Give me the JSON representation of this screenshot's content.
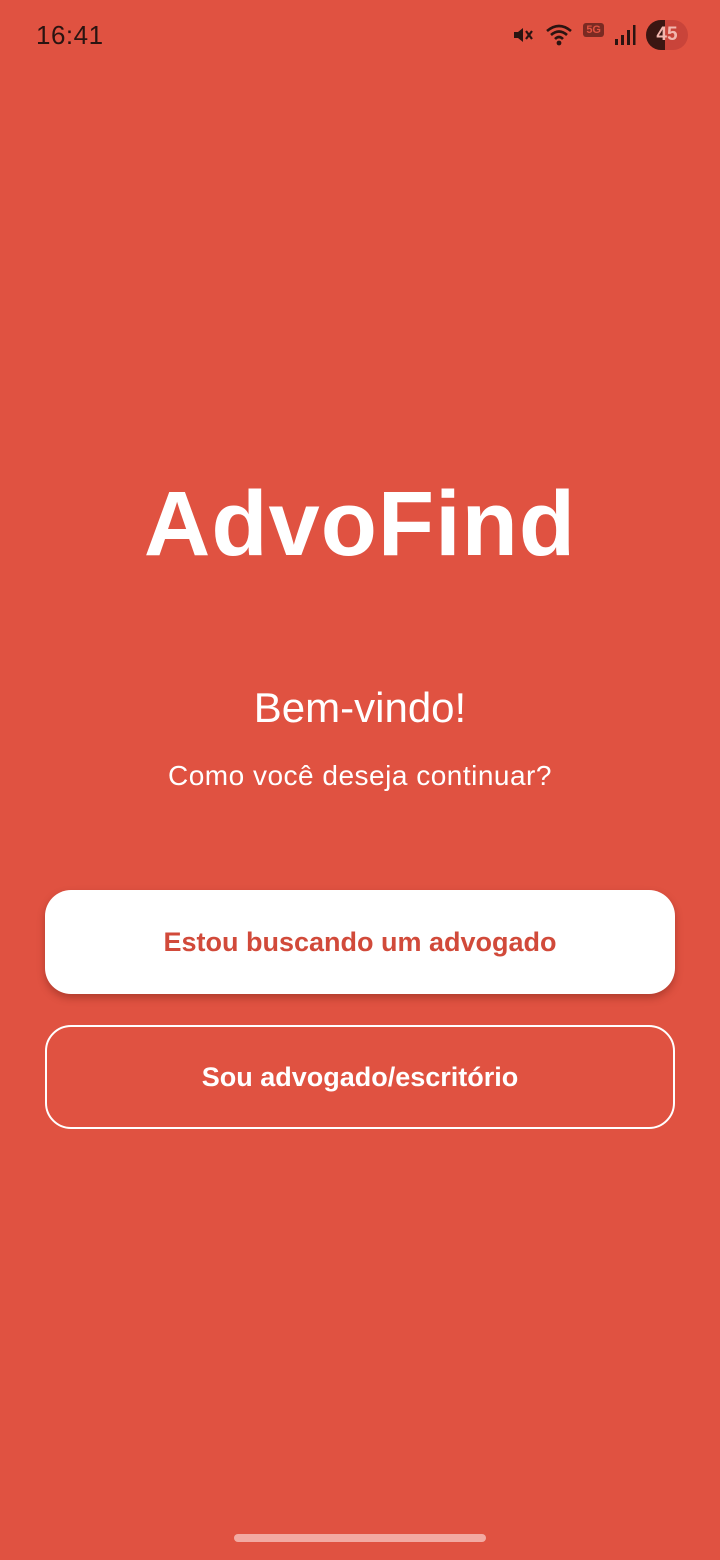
{
  "status_bar": {
    "time": "16:41",
    "network_label": "5G",
    "battery_level": "45",
    "icons": [
      "mute-icon",
      "wifi-icon",
      "signal-icon",
      "battery-icon"
    ]
  },
  "app": {
    "title": "AdvoFind",
    "welcome": "Bem-vindo!",
    "subtitle": "Como você deseja continuar?"
  },
  "actions": {
    "client_label": "Estou buscando um advogado",
    "lawyer_label": "Sou advogado/escritório"
  },
  "colors": {
    "background": "#E05241",
    "primary_button_bg": "#FFFFFF",
    "primary_button_text": "#D14A3A",
    "secondary_button_text": "#FFFFFF"
  }
}
